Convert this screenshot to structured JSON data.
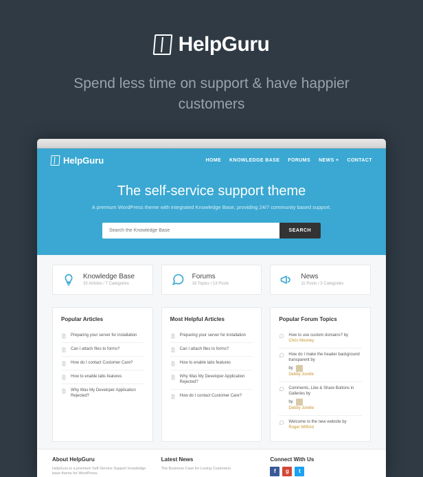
{
  "promo": {
    "brand": "HelpGuru",
    "tagline": "Spend less time on support & have happier customers"
  },
  "app": {
    "logo": "HelpGuru",
    "nav": [
      "HOME",
      "KNOWLEDGE BASE",
      "FORUMS",
      "NEWS +",
      "CONTACT"
    ],
    "hero_title": "The self-service support theme",
    "hero_sub": "A premium WordPress theme with integrated Knowledge Base, providing 24/7 community based support.",
    "search": {
      "placeholder": "Search the Knowledge Base",
      "button": "SEARCH"
    },
    "cards": [
      {
        "title": "Knowledge Base",
        "meta": "33 Articles / 7 Categories"
      },
      {
        "title": "Forums",
        "meta": "16 Topics / 13 Posts"
      },
      {
        "title": "News",
        "meta": "11 Posts / 3 Categories"
      }
    ],
    "columns": {
      "popular_articles": {
        "title": "Popular Articles",
        "items": [
          "Preparing your server for installation",
          "Can I attach files to forms?",
          "How do I contact Customer Care?",
          "How to enable labs features",
          "Why Was My Developer Application Rejected?"
        ]
      },
      "helpful_articles": {
        "title": "Most Helpful Articles",
        "items": [
          "Preparing your server for installation",
          "Can I attach files to forms?",
          "How to enable labs features",
          "Why Was My Developer Application Rejected?",
          "How do I contact Customer Care?"
        ]
      },
      "forum_topics": {
        "title": "Popular Forum Topics",
        "items": [
          {
            "title": "How to use custom domains?",
            "by": "by ",
            "author": "Chris Mooney"
          },
          {
            "title": "How do I make the header background transparent",
            "by": "by ",
            "author": "Debby Jorelle",
            "avatar": true
          },
          {
            "title": "Comments, Like & Share Buttons in Galleries",
            "by": "by ",
            "author": "Debby Jorelle",
            "avatar": true
          },
          {
            "title": "Welcome to the new website",
            "by": "by ",
            "author": "Roger Wilford"
          }
        ]
      }
    },
    "footer": {
      "about": {
        "title": "About HelpGuru",
        "text": "HelpGuru is a premium Self-Service Support knowledge base theme for WordPress."
      },
      "latest": {
        "title": "Latest News",
        "text": "The Business Case for Loving Customers"
      },
      "connect": {
        "title": "Connect With Us"
      }
    }
  }
}
